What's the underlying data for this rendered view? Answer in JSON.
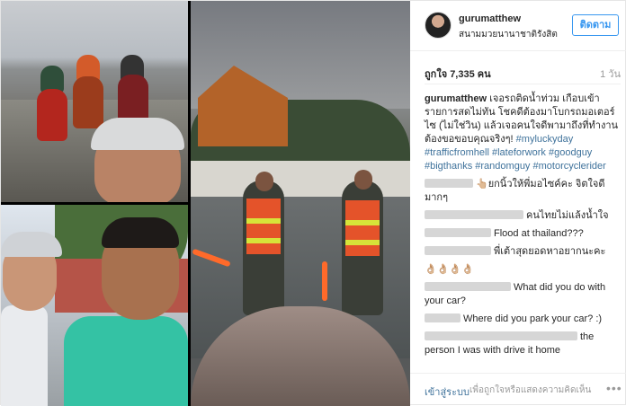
{
  "post": {
    "username": "gurumatthew",
    "location": "สนามมวยนานาชาติรังสิต",
    "follow_label": "ติดตาม",
    "likes_text": "ถูกใจ 7,335 คน",
    "time_ago": "1 วัน",
    "caption": {
      "user": "gurumatthew",
      "text": "เจอรถติดน้ำท่วม เกือบเข้ารายการสดไม่ทัน โชคดีต้องมาโบกรถมอเตอร์ไซ (ไม่ใช่วิน) แล้วเจอคนใจดีพามาถึงที่ทำงาน ต้องขอขอบคุณจริงๆ!",
      "hashtags": [
        "#myluckyday",
        "#trafficfromhell",
        "#lateforwork",
        "#goodguy",
        "#bigthanks",
        "#randomguy",
        "#motorcyclerider"
      ]
    },
    "comments": [
      {
        "text": "👆🏼ยกนิ้วให้พี่มอไซค์คะ จิตใจดีมากๆ"
      },
      {
        "text": "คนไทยไม่แล้งน้ำใจ"
      },
      {
        "text": "Flood at thailand???"
      },
      {
        "text": "พี่เต้าสุดยอดหาอยากนะคะ"
      },
      {
        "text": "👌🏼👌🏼👌🏼👌🏼"
      },
      {
        "text": "What did you do with your car?"
      },
      {
        "text": "Where did you park your car? :)"
      },
      {
        "text": "the person I was with drive it home"
      }
    ]
  },
  "footer": {
    "login_label": "เข้าสู่ระบบ",
    "login_hint": "เพื่อถูกใจหรือแสดงความคิดเห็น",
    "more_icon": "more-horizontal-icon"
  },
  "colors": {
    "link_blue": "#3f729b",
    "follow_blue": "#3897f0",
    "border": "#efefef"
  }
}
